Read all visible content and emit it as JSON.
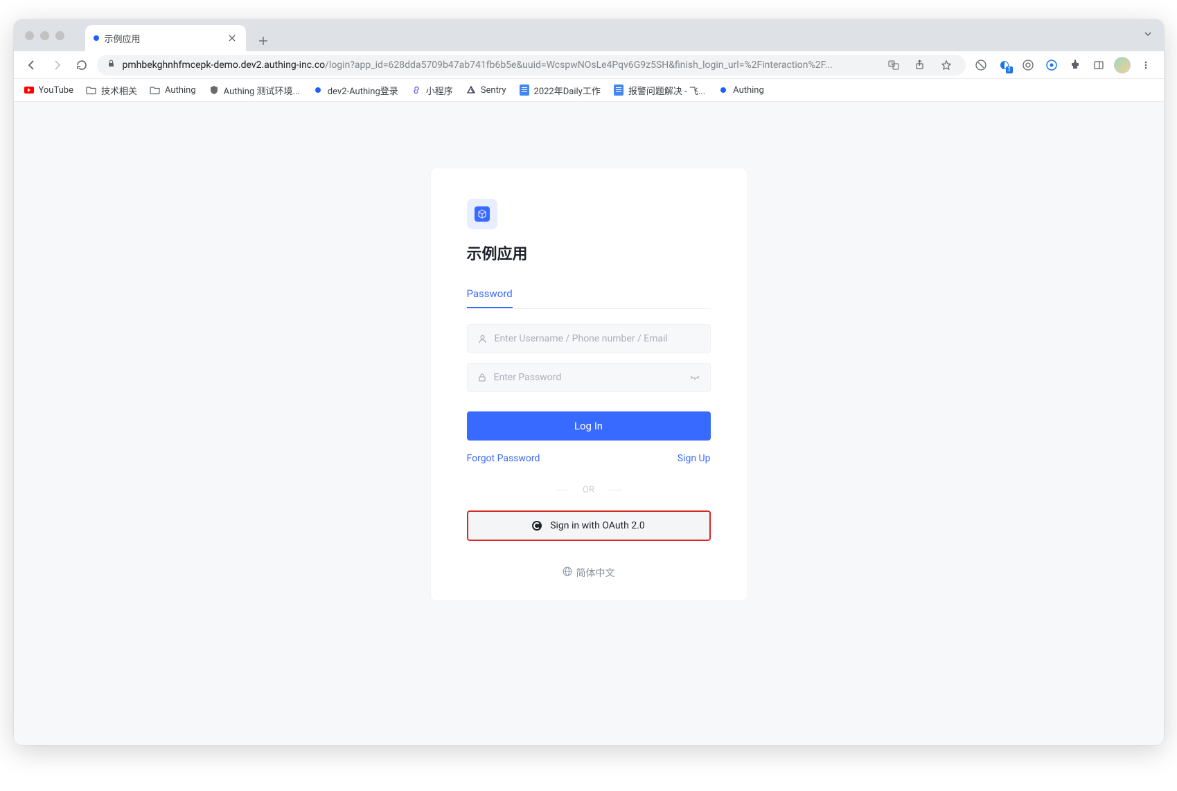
{
  "browser": {
    "tab": {
      "title": "示例应用"
    },
    "url_domain": "pmhbekghnhfmcepk-demo.dev2.authing-inc.co",
    "url_path": "/login?app_id=628dda5709b47ab741fb6b5e&uuid=WcspwNOsLe4Pqv6G9z5SH&finish_login_url=%2Finteraction%2F...",
    "ext_badge": "3"
  },
  "bookmarks": {
    "items": [
      {
        "label": "YouTube"
      },
      {
        "label": "技术相关"
      },
      {
        "label": "Authing"
      },
      {
        "label": "Authing 测试环境..."
      },
      {
        "label": "dev2-Authing登录"
      },
      {
        "label": "小程序"
      },
      {
        "label": "Sentry"
      },
      {
        "label": "2022年Daily工作"
      },
      {
        "label": "报警问题解决 - 飞..."
      },
      {
        "label": "Authing"
      }
    ]
  },
  "login": {
    "app_title": "示例应用",
    "tab_password": "Password",
    "username_placeholder": "Enter Username / Phone number / Email",
    "password_placeholder": "Enter Password",
    "login_button": "Log In",
    "forgot_link": "Forgot Password",
    "signup_link": "Sign Up",
    "or_divider": "OR",
    "oauth_button": "Sign in with OAuth 2.0",
    "lang_label": "简体中文"
  }
}
